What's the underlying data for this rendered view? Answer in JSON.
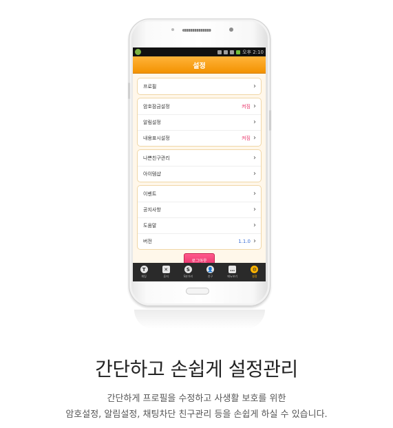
{
  "statusbar": {
    "time": "오후 2:10"
  },
  "header": {
    "title": "설정"
  },
  "settings": {
    "groups": [
      {
        "rows": [
          {
            "label": "프로필",
            "value": ""
          }
        ]
      },
      {
        "rows": [
          {
            "label": "암호잠금설정",
            "value": "켜짐"
          },
          {
            "label": "알림설정",
            "value": ""
          },
          {
            "label": "내용표시설정",
            "value": "켜짐"
          }
        ]
      },
      {
        "rows": [
          {
            "label": "나쁜친구관리",
            "value": ""
          },
          {
            "label": "아이템샵",
            "value": ""
          }
        ]
      },
      {
        "rows": [
          {
            "label": "이벤트",
            "value": ""
          },
          {
            "label": "공지사항",
            "value": ""
          },
          {
            "label": "도움말",
            "value": ""
          },
          {
            "label": "버전",
            "value": "1.1.0"
          }
        ]
      }
    ],
    "logout_label": "로그아웃"
  },
  "tabbar": {
    "tabs": [
      {
        "label": "채팅",
        "glyph": "T",
        "icon": "chat-icon"
      },
      {
        "label": "휴지",
        "glyph": "✕",
        "icon": "trash-icon"
      },
      {
        "label": "S분거리",
        "glyph": "S",
        "icon": "distance-icon"
      },
      {
        "label": "친구",
        "glyph": "👤",
        "icon": "friends-icon"
      },
      {
        "label": "메뉴보기",
        "glyph": "…",
        "icon": "menu-icon"
      },
      {
        "label": "설정",
        "glyph": "⚙",
        "icon": "gear-icon"
      }
    ]
  },
  "caption": {
    "headline": "간단하고 손쉽게 설정관리",
    "line1": "간단하게 프로필을 수정하고 사생활 보호를 위한",
    "line2": "암호설정, 알림설정, 채팅차단 친구관리 등을 손쉽게 하실 수 있습니다."
  },
  "colors": {
    "accent": "#f39200",
    "on_value": "#e8376b",
    "version_value": "#3b6fd6",
    "logout": "#e62e68"
  }
}
